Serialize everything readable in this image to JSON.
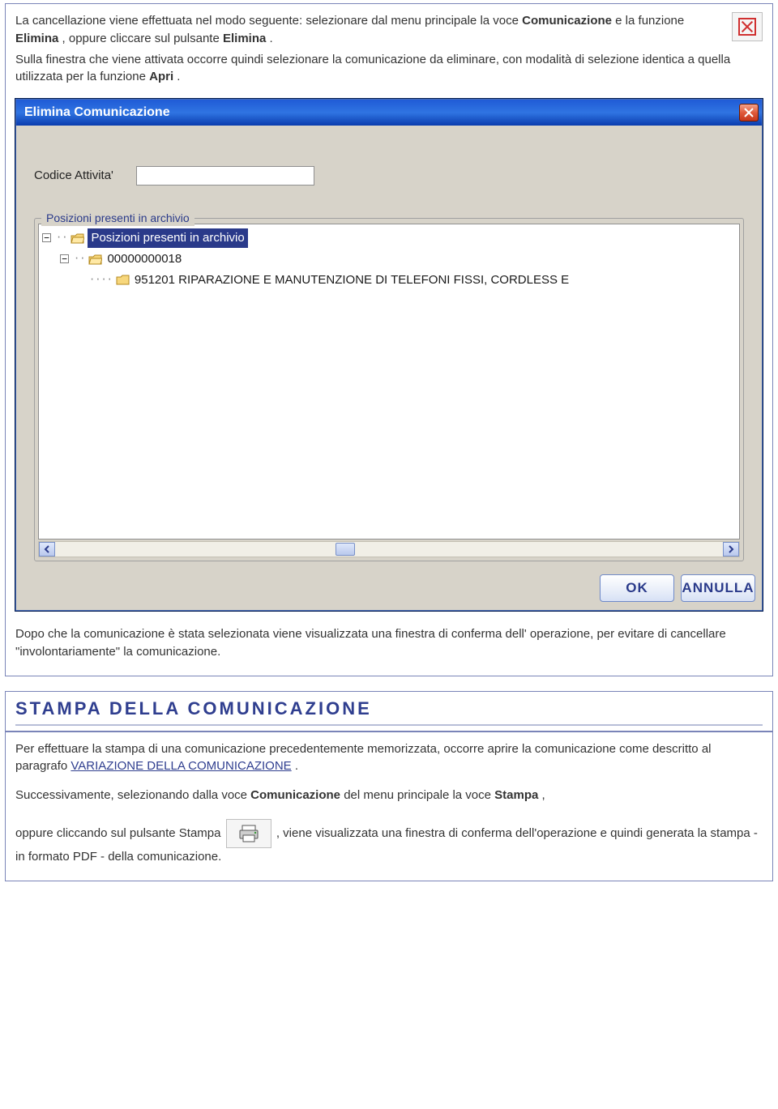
{
  "section1": {
    "p1a": "La cancellazione viene effettuata nel modo seguente: selezionare dal menu principale la voce ",
    "p1b": "Comunicazione",
    "p1c": " e la funzione ",
    "p1d": "Elimina",
    "p1e": ", oppure cliccare sul pulsante ",
    "p1f": "Elimina",
    "p1g": ".",
    "p2a": "Sulla finestra che viene attivata occorre quindi selezionare la comunicazione da eliminare, con modalità di selezione identica a quella utilizzata per la funzione ",
    "p2b": "Apri",
    "p2c": ".",
    "p3": "Dopo che la comunicazione è stata selezionata viene visualizzata una finestra di conferma dell' operazione, per evitare di cancellare \"involontariamente\" la comunicazione."
  },
  "dialog": {
    "title": "Elimina Comunicazione",
    "field_label": "Codice Attivita'",
    "group_caption": "Posizioni presenti in archivio",
    "tree": {
      "root": "Posizioni presenti in archivio",
      "child": "00000000018",
      "leaf": "951201 RIPARAZIONE E MANUTENZIONE DI TELEFONI FISSI, CORDLESS E"
    },
    "ok": "OK",
    "cancel": "ANNULLA"
  },
  "section2": {
    "heading": "STAMPA DELLA COMUNICAZIONE",
    "p1a": "Per effettuare la stampa di una comunicazione precedentemente memorizzata, occorre aprire la comunicazione come descritto al paragrafo ",
    "p1link": "VARIAZIONE DELLA COMUNICAZIONE",
    "p1b": ".",
    "p2a": "Successivamente, selezionando dalla voce ",
    "p2b": "Comunicazione",
    "p2c": " del menu principale la voce ",
    "p2d": "Stampa",
    "p2e": ",",
    "p3a": "oppure cliccando sul pulsante Stampa ",
    "p3b": ", viene visualizzata una finestra di conferma dell'operazione e quindi generata la stampa - in formato PDF - della comunicazione."
  }
}
